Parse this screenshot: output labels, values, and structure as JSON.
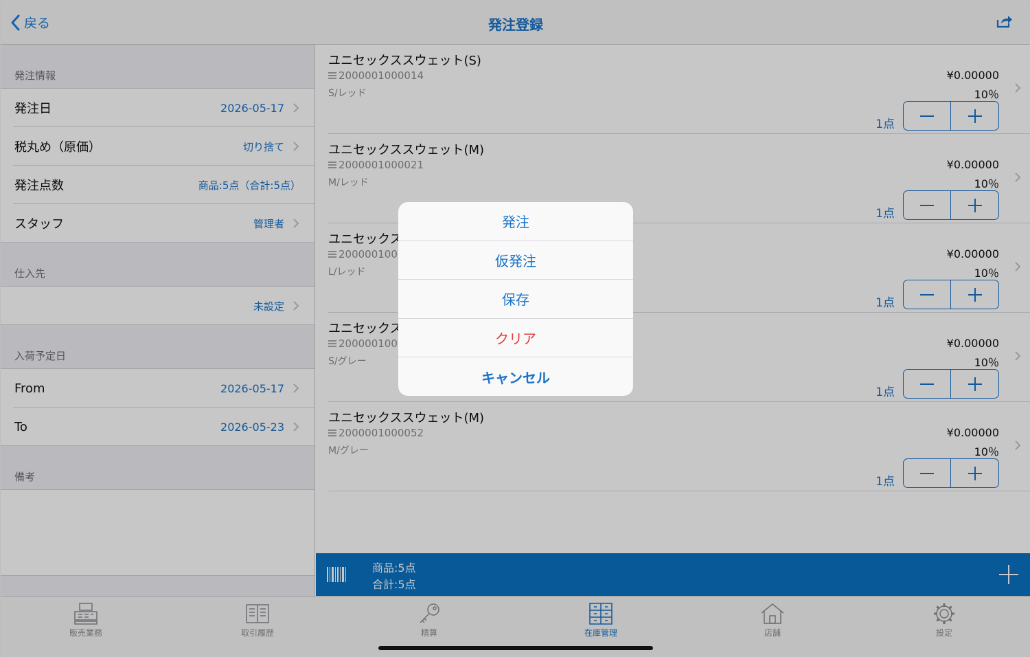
{
  "nav": {
    "back_label": "戻る",
    "title": "発注登録"
  },
  "left": {
    "order_info_header": "発注情報",
    "order_date": {
      "label": "発注日",
      "value": "2026-05-17"
    },
    "tax_rounding": {
      "label": "税丸め（原価）",
      "value": "切り捨て"
    },
    "order_count": {
      "label": "発注点数",
      "value": "商品:5点（合計:5点）"
    },
    "staff": {
      "label": "スタッフ",
      "value": "管理者"
    },
    "supplier_header": "仕入先",
    "supplier_value": "未設定",
    "arrival_header": "入荷予定日",
    "arrival_from": {
      "label": "From",
      "value": "2026-05-17"
    },
    "arrival_to": {
      "label": "To",
      "value": "2026-05-23"
    },
    "notes_header": "備考"
  },
  "items": [
    {
      "name": "ユニセックススウェット(S)",
      "code": "2000001000014",
      "variant": "S/レッド",
      "price": "¥0.00000",
      "tax": "10％",
      "qty": "1点"
    },
    {
      "name": "ユニセックススウェット(M)",
      "code": "2000001000021",
      "variant": "M/レッド",
      "price": "¥0.00000",
      "tax": "10％",
      "qty": "1点"
    },
    {
      "name": "ユニセックス",
      "code": "200000100",
      "variant": "L/レッド",
      "price": "¥0.00000",
      "tax": "10％",
      "qty": "1点"
    },
    {
      "name": "ユニセックス",
      "code": "200000100",
      "variant": "S/グレー",
      "price": "¥0.00000",
      "tax": "10％",
      "qty": "1点"
    },
    {
      "name": "ユニセックススウェット(M)",
      "code": "2000001000052",
      "variant": "M/グレー",
      "price": "¥0.00000",
      "tax": "10％",
      "qty": "1点"
    }
  ],
  "summary": {
    "products": "商品:5点",
    "total": "合計:5点"
  },
  "action_sheet": {
    "order": "発注",
    "provisional": "仮発注",
    "save": "保存",
    "clear": "クリア",
    "cancel": "キャンセル"
  },
  "tabs": [
    {
      "label": "販売業務",
      "icon": "register-icon"
    },
    {
      "label": "取引履歴",
      "icon": "book-icon"
    },
    {
      "label": "精算",
      "icon": "key-icon"
    },
    {
      "label": "在庫管理",
      "icon": "inventory-icon",
      "active": true
    },
    {
      "label": "店舗",
      "icon": "store-icon"
    },
    {
      "label": "設定",
      "icon": "gear-icon"
    }
  ],
  "colors": {
    "accent": "#1a73c8",
    "bar": "#0a72c2",
    "danger": "#e8393a"
  }
}
